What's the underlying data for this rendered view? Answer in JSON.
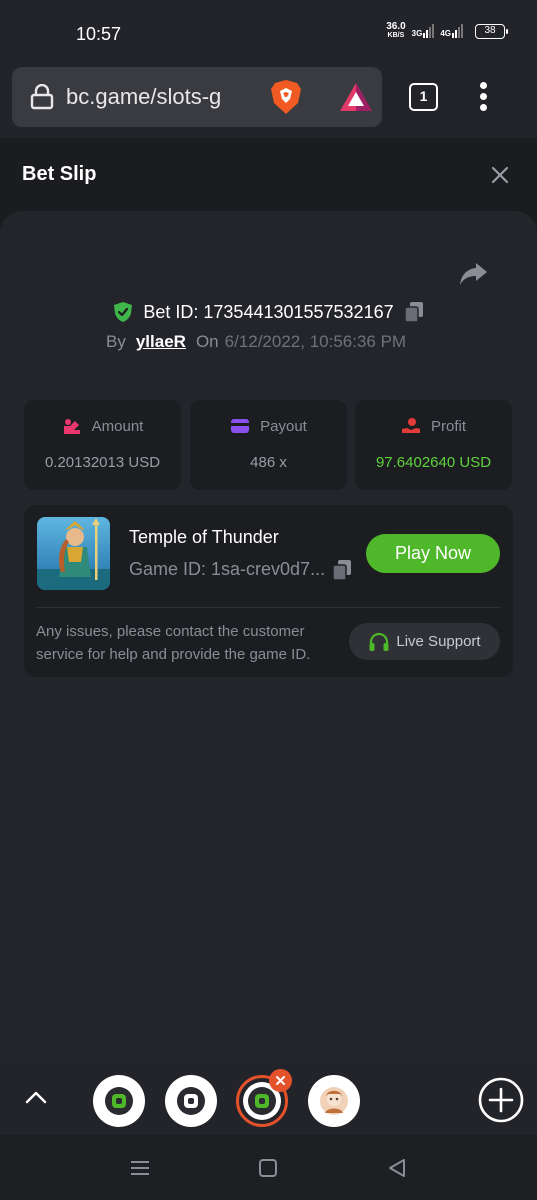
{
  "status_bar": {
    "time": "10:57",
    "net_speed": "36.0",
    "net_speed_unit": "KB/S",
    "sim1": "3G",
    "sim2": "4G",
    "battery": "38"
  },
  "browser": {
    "url": "bc.game/slots-g",
    "tab_count": "1"
  },
  "bet_slip": {
    "title": "Bet Slip",
    "bet_id_label": "Bet ID: 1735441301557532167",
    "by_label": "By",
    "username": "yllaeR",
    "on_label": "On",
    "date": "6/12/2022, 10:56:36 PM"
  },
  "stats": [
    {
      "label": "Amount",
      "value": "0.20132013 USD",
      "icon": "amount-icon",
      "color": "#e8386e"
    },
    {
      "label": "Payout",
      "value": "486 x",
      "icon": "payout-icon",
      "color": "#8c4ff0"
    },
    {
      "label": "Profit",
      "value": "97.6402640 USD",
      "icon": "profit-icon",
      "color": "#e23b3b"
    }
  ],
  "game": {
    "title": "Temple of Thunder",
    "game_id": "Game ID: 1sa-crev0d7...",
    "play_label": "Play Now",
    "help_text": "Any issues, please contact the customer service for help and provide the game ID.",
    "support_label": "Live Support"
  },
  "colors": {
    "accent_green": "#4fb82a",
    "profit_green": "#5fd33c",
    "tab_active": "#e3522b"
  }
}
